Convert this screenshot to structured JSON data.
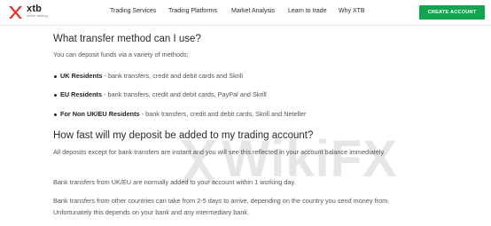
{
  "header": {
    "logo_name": "xtb",
    "logo_tagline": "online trading",
    "nav": [
      "Trading Services",
      "Trading Platforms",
      "Market Analysis",
      "Learn to trade",
      "Why XTB"
    ],
    "cta_label": "CREATE ACCOUNT",
    "cta_color": "#14a44d"
  },
  "section1": {
    "heading": "What transfer method can I use?",
    "intro": "You can deposit funds via a variety of methods;",
    "bullets": [
      {
        "label": "UK Residents",
        "text": " - bank transfers, credit and debit cards and Skrill"
      },
      {
        "label": "EU Residents",
        "text": " - bank transfers, credit and debit cards, PayPal and Skrill"
      },
      {
        "label": "For Non UK/EU Residents",
        "text": " - bank transfers, credit and debit cards, Skrill and Neteller"
      }
    ]
  },
  "section2": {
    "heading": "How fast will my deposit be added to my trading account?",
    "paragraphs": [
      "All deposits except for bank transfers are instant and you will see this reflected in your account balance immediately.",
      "Bank transfers from UK/EU are normally added to your account within 1 working day.",
      "Bank transfers from other countries can take from 2-5 days to arrive, depending on the country you send money from. Unfortunately this depends on your bank and any intermediary bank."
    ]
  },
  "watermark": {
    "text": "WikiFX",
    "icon": "wikifx-logo-icon"
  }
}
